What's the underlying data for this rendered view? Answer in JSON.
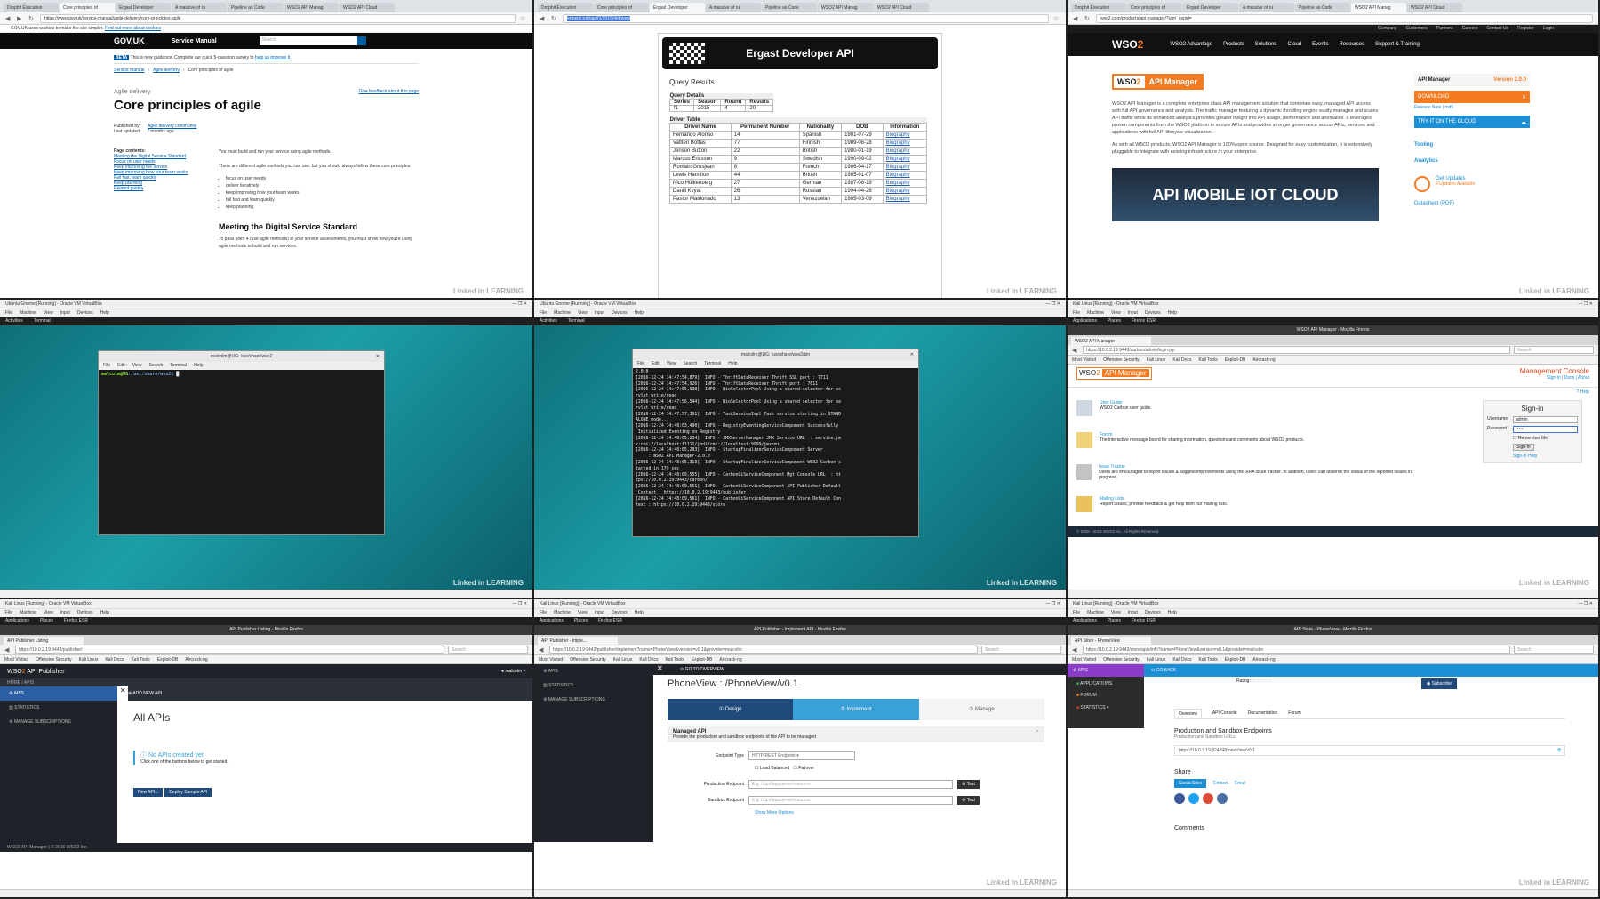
{
  "panels": {
    "govuk": {
      "tabs": [
        "Dropbit Execution",
        "Core principles of",
        "Ergast Developer",
        "A massive of ru",
        "Pipeline as Code",
        "WSO2 API Manag",
        "WSO2 API Cloud"
      ],
      "url": "https://www.gov.uk/service-manual/agile-delivery/core-principles-agile",
      "cookie_notice": "GOV.UK uses cookies to make the site simpler.",
      "cookie_link": "Find out more about cookies",
      "logo": "GOV.UK",
      "service_manual": "Service Manual",
      "search_placeholder": "Search",
      "beta_tag": "BETA",
      "beta_text": "This is new guidance. Complete our quick 5-question survey to",
      "beta_link": "help us improve it",
      "breadcrumbs": [
        "Service manual",
        "Agile delivery",
        "Core principles of agile"
      ],
      "eyebrow": "Agile delivery",
      "title": "Core principles of agile",
      "feedback_link": "Give feedback about this page",
      "published_by": "Published by:",
      "publisher": "Agile delivery community",
      "last_updated": "Last updated:",
      "updated_ago": "7 months ago",
      "contents_title": "Page contents:",
      "contents": [
        "Meeting the Digital Service Standard",
        "Focus on user needs",
        "Keep improving the service",
        "Keep improving how your team works",
        "Fail fast, learn quickly",
        "Keep planning",
        "Related guides"
      ],
      "intro": "You must build and run your service using agile methods.",
      "intro2": "There are different agile methods you can use, but you should always follow these core principles:",
      "bullets": [
        "focus on user needs",
        "deliver iteratively",
        "keep improving how your team works",
        "fail fast and learn quickly",
        "keep planning"
      ],
      "h2": "Meeting the Digital Service Standard",
      "p2": "To pass point 4 (use agile methods) in your service assessments, you must show how you're using agile methods to build and run services."
    },
    "ergast": {
      "url": "ergast.com/api/f1/2015/4/drivers",
      "banner": "Ergast Developer API",
      "query_results": "Query Results",
      "query_details": "Query Details",
      "qd_headers": [
        "Series",
        "Season",
        "Round",
        "Results"
      ],
      "qd_values": [
        "f1",
        "2015",
        "4",
        "20"
      ],
      "driver_table": "Driver Table",
      "headers": [
        "Driver Name",
        "Permanent Number",
        "Nationality",
        "DOB",
        "Information"
      ],
      "rows": [
        [
          "Fernando Alonso",
          "14",
          "Spanish",
          "1981-07-29",
          "Biography"
        ],
        [
          "Valtteri Bottas",
          "77",
          "Finnish",
          "1989-08-28",
          "Biography"
        ],
        [
          "Jenson Button",
          "22",
          "British",
          "1980-01-19",
          "Biography"
        ],
        [
          "Marcus Ericsson",
          "9",
          "Swedish",
          "1990-09-02",
          "Biography"
        ],
        [
          "Romain Grosjean",
          "8",
          "French",
          "1986-04-17",
          "Biography"
        ],
        [
          "Lewis Hamilton",
          "44",
          "British",
          "1985-01-07",
          "Biography"
        ],
        [
          "Nico Hülkenberg",
          "27",
          "German",
          "1987-08-19",
          "Biography"
        ],
        [
          "Daniil Kvyat",
          "26",
          "Russian",
          "1994-04-26",
          "Biography"
        ],
        [
          "Pastor Maldonado",
          "13",
          "Venezuelan",
          "1985-03-09",
          "Biography"
        ]
      ]
    },
    "wso2site": {
      "url": "wso2.com/products/api-manager/?utm_expid=",
      "top_links": [
        "Company",
        "Customers",
        "Partners",
        "Careers",
        "Contact Us",
        "Register",
        "Login"
      ],
      "nav": [
        "WSO2 Advantage",
        "Products",
        "Solutions",
        "Cloud",
        "Events",
        "Resources",
        "Support & Training"
      ],
      "product_badge": "API Manager",
      "desc1": "WSO2 API Manager is a complete enterprise class API management solution that combines easy, managed API access with full API governance and analysis. The traffic manager featuring a dynamic throttling engine easily manages and scales API traffic while its enhanced analytics provides greater insight into API usage, performance and anomalies. It leverages proven components from the WSO2 platform to secure APIs and provides stronger governance across APIs, services and applications with full API lifecycle visualization.",
      "desc2": "As with all WSO2 products, WSO2 API Manager is 100% open source. Designed for easy customization, it is extensively pluggable to integrate with existing infrastructure in your enterprise.",
      "box_title": "API Manager",
      "version": "Version 2.0.0",
      "download": "DOWNLOAD",
      "release_note": "Release Note",
      "md5": "md5",
      "try_cloud": "TRY IT ON THE CLOUD",
      "tooling": "Tooling",
      "analytics": "Analytics",
      "get_updates": "Get Updates",
      "updates_available": "9 Updates Available",
      "datasheet": "Datasheet (PDF)",
      "promo": "API MOBILE IOT CLOUD"
    },
    "term1": {
      "vb_title": "Ubuntu Gnome [Running] - Oracle VM VirtualBox",
      "vb_menu": [
        "File",
        "Machine",
        "View",
        "Input",
        "Devices",
        "Help"
      ],
      "top_activities": "Activities",
      "top_app": "Terminal",
      "term_title": "malcolm@UG: /usr/share/wso2",
      "term_menu": [
        "File",
        "Edit",
        "View",
        "Search",
        "Terminal",
        "Help"
      ],
      "prompt_user": "malcolm@UG",
      "prompt_path": ":/usr/share/wso2$"
    },
    "term2": {
      "vb_title": "Ubuntu Gnome [Running] - Oracle VM VirtualBox",
      "term_title": "malcolm@UG: /usr/share/wso2/bin",
      "log": [
        "2.0.0",
        "[2016-12-24 14:47:54,879]  INFO - ThriftDataReceiver Thrift SSL port : 7711",
        "[2016-12-24 14:47:54,926]  INFO - ThriftDataReceiver Thrift port : 7611",
        "[2016-12-24 14:47:55,938]  INFO - NioSelectorPool Using a shared selector for se",
        "rvlet write/read",
        "[2016-12-24 14:47:56,544]  INFO - NioSelectorPool Using a shared selector for se",
        "rvlet write/read",
        "[2016-12-24 14:47:57,391]  INFO - TaskServiceImpl Task service starting in STAND",
        "ALONE mode...",
        "[2016-12-24 14:48:03,490]  INFO - RegistryEventingServiceComponent Successfully",
        " Initialized Eventing on Registry",
        "[2016-12-24 14:48:05,234]  INFO - JMXServerManager JMX Service URL  : service:jm",
        "x:rmi://localhost:11111/jndi/rmi://localhost:9999/jmxrmi",
        "[2016-12-24 14:48:05,293]  INFO - StartupFinalizerServiceComponent Server",
        "     : WSO2 API Manager-2.0.0",
        "[2016-12-24 14:48:05,313]  INFO - StartupFinalizerServiceComponent WSO2 Carbon s",
        "tarted in 179 sec",
        "[2016-12-24 14:48:09,555]  INFO - CarbonUiServiceComponent Mgt Console URL  : ht",
        "tps://10.0.2.19:9443/carbon/",
        "[2016-12-24 14:48:09,561]  INFO - CarbonUiServiceComponent API Publisher Default",
        " Context : https://10.0.2.19:9443/publisher",
        "[2016-12-24 14:48:09,561]  INFO - CarbonUiServiceComponent API Store Default Con",
        "text : https://10.0.2.19:9443/store"
      ]
    },
    "carbon": {
      "vb_title": "Kali Linux [Running] - Oracle VM VirtualBox",
      "top_apps": "Applications",
      "top_places": "Places",
      "top_ff": "Firefox ESR",
      "ff_title": "WSO2 API Manager - Mozilla Firefox",
      "tab": "WSO2 API Manager",
      "url": "https://10.0.2.19:9443/carbon/admin/login.jsp",
      "search": "Search",
      "bookmarks": [
        "Most Visited",
        "Offensive Security",
        "Kali Linux",
        "Kali Docs",
        "Kali Tools",
        "Exploit-DB",
        "Aircrack-ng"
      ],
      "console_title": "Management Console",
      "header_links": [
        "Sign-in",
        "Docs",
        "About"
      ],
      "help": "Help",
      "items": [
        {
          "title": "User Guide",
          "text": "WSO2 Carbon user guide."
        },
        {
          "title": "Forum",
          "text": "The interactive message board for sharing information, questions and comments about WSO2 products."
        },
        {
          "title": "Issue Tracker",
          "text": "Users are encouraged to report issues & suggest improvements using the JIRA issue tracker. In addition, users can observe the status of the reported issues in progress."
        },
        {
          "title": "Mailing Lists",
          "text": "Report issues, provide feedback & get help from our mailing lists."
        }
      ],
      "signin_title": "Sign-in",
      "username_label": "Username",
      "username_value": "admin",
      "password_label": "Password",
      "password_value": "•••••",
      "remember": "Remember Me",
      "signin_btn": "Sign-in",
      "signin_help": "Sign-in Help",
      "footer": "© 2005 - 2016 WSO2 Inc. All Rights Reserved."
    },
    "publisher": {
      "ff_title": "API Publisher Listing - Mozilla Firefox",
      "tab": "API Publisher Listing",
      "url": "https://10.0.2.19:9443/publisher/",
      "brand": "API Publisher",
      "user": "malcolm",
      "crumbs": "HOME / APIS",
      "side": [
        "APIS",
        "STATISTICS",
        "MANAGE SUBSCRIPTIONS"
      ],
      "add_new": "ADD NEW API",
      "heading": "All APIs",
      "empty_title": "No APIs created yet",
      "empty_text": "Click one of the buttons below to get started.",
      "new_api": "New API...",
      "deploy_sample": "Deploy Sample API",
      "footer": "WSO2 API Manager | © 2016 WSO2 Inc"
    },
    "implement": {
      "ff_title": "API Publisher - Implement API - Mozilla Firefox",
      "tab": "API Publisher - Imple...",
      "url": "https://10.0.2.19:9443/publisher/implement?name=PhoneView&version=v0.1&provider=malcolm",
      "side": [
        "APIS",
        "STATISTICS",
        "MANAGE SUBSCRIPTIONS"
      ],
      "go_overview": "GO TO OVERVIEW",
      "api_title": "PhoneView : /PhoneView/v0.1",
      "steps": [
        "Design",
        "Implement",
        "Manage"
      ],
      "managed_api": "Managed API",
      "managed_desc": "Provide the production and sandbox endpoints of the API to be managed",
      "endpoint_type_label": "Endpoint Type",
      "endpoint_type_value": "HTTP/REST Endpoint",
      "load_balanced": "Load Balanced",
      "failover": "Failover",
      "prod_label": "Production Endpoint",
      "prod_placeholder": "E.g: http://appserver/resource",
      "sandbox_label": "Sandbox Endpoint",
      "sandbox_placeholder": "E.g: http://appserver/resource",
      "test": "Test",
      "more_options": "Show More Options"
    },
    "store": {
      "ff_title": "API Store - PhoneView - Mozilla Firefox",
      "tab": "API Store - PhoneView",
      "url": "https://10.0.2.19:9443/store/apis/info?name=PhoneView&version=v0.1&provider=malcolm",
      "side": [
        "APIS",
        "APPLICATIONS",
        "FORUM",
        "STATISTICS"
      ],
      "go_back": "GO BACK",
      "rating": "Rating:",
      "subscribe": "Subscribe",
      "tabs": [
        "Overview",
        "API Console",
        "Documentation",
        "Forum"
      ],
      "endpoints_title": "Production and Sandbox Endpoints",
      "endpoints_sub": "Production and Sandbox URLs:",
      "endpoint_url": "https://10.0.2.19:8243/PhoneView/v0.1",
      "share_title": "Share",
      "share_tabs": [
        "Social Sites",
        "Embed",
        "Email"
      ],
      "comments": "Comments"
    },
    "watermark": "Linked in LEARNING"
  },
  "colors": {
    "gov_black": "#0b0c0c",
    "gov_link": "#005ea5",
    "wso2_orange": "#f47b20",
    "wso2_blue": "#2a5fa4",
    "store_purple": "#8a3cc8",
    "store_blue": "#1b8ed4",
    "teal_desktop": "#1c9fa8"
  }
}
